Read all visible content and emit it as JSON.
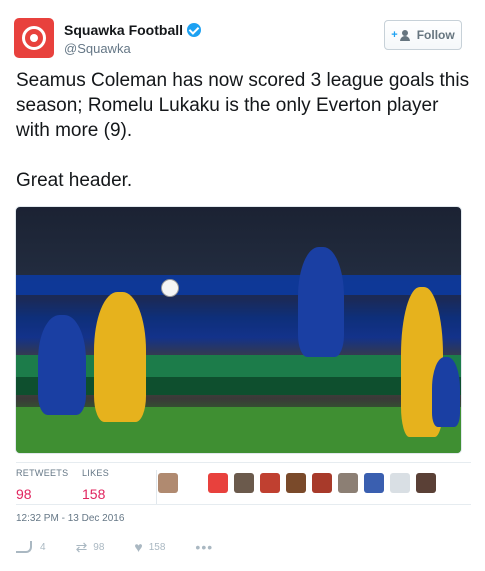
{
  "author": {
    "name": "Squawka Football",
    "handle": "@Squawka"
  },
  "follow_button": {
    "label": "Follow"
  },
  "tweet": {
    "text": "Seamus Coleman has now scored 3 league goals this season; Romelu Lukaku is the only Everton player with more (9).\n\nGreat header."
  },
  "stats": {
    "retweets_label": "RETWEETS",
    "retweets_value": "98",
    "likes_label": "LIKES",
    "likes_value": "158"
  },
  "timestamp": "12:32 PM - 13 Dec 2016",
  "actions": {
    "reply_count": "4",
    "retweet_count": "98",
    "like_count": "158"
  },
  "colors": {
    "accent": "#1da1f2",
    "stat_value": "#e0245e",
    "avatar_bg": "#e8413d"
  },
  "icons": [
    "verified-icon",
    "follow-user-icon",
    "reply-icon",
    "retweet-icon",
    "like-icon",
    "more-icon"
  ]
}
